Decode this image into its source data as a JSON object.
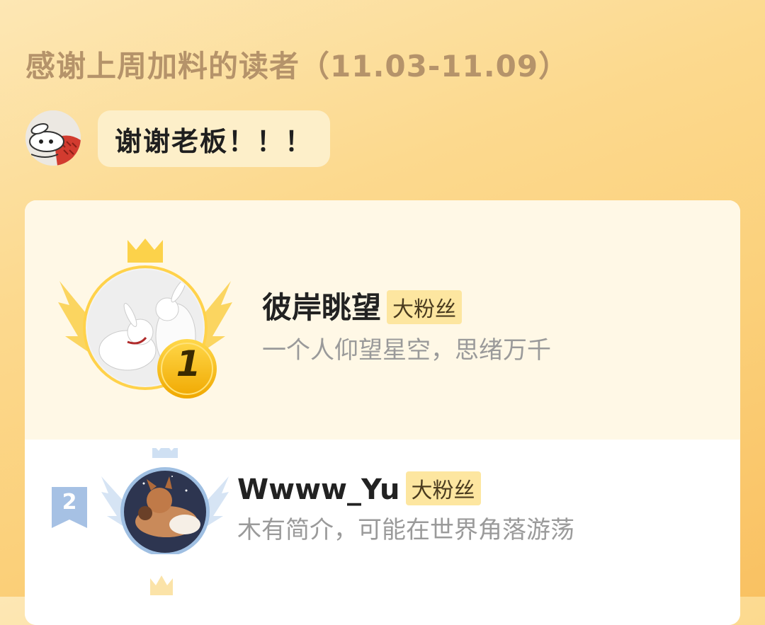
{
  "header": {
    "title": "感谢上周加料的读者（11.03-11.09）"
  },
  "host": {
    "avatar_icon": "cartoon-bunny-avatar",
    "message": "谢谢老板！！！"
  },
  "ranking": [
    {
      "rank": "1",
      "name": "彼岸眺望",
      "badge": "大粉丝",
      "bio": "一个人仰望星空，思绪万千",
      "avatar_icon": "white-rabbits-avatar"
    },
    {
      "rank": "2",
      "name": "Wwww_Yu",
      "badge": "大粉丝",
      "bio": "木有简介，可能在世界角落游荡",
      "avatar_icon": "fox-night-avatar"
    }
  ],
  "colors": {
    "gold": "#f5b400",
    "silver": "#a9c4e4",
    "title": "#b5936a"
  }
}
